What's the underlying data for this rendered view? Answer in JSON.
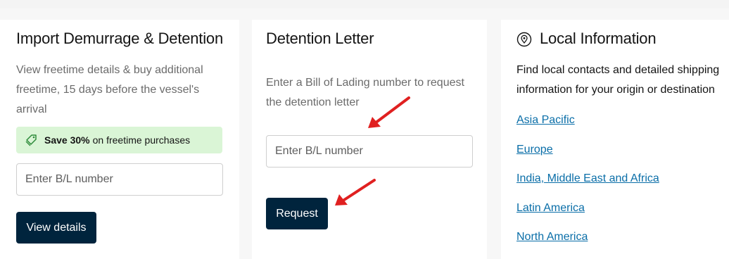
{
  "import_card": {
    "title": "Import Demurrage & Detention",
    "description": "View freetime details & buy additional freetime, 15 days before the vessel's arrival",
    "promo": {
      "bold": "Save 30%",
      "text": "on freetime purchases",
      "icon": "tag-icon"
    },
    "input_placeholder": "Enter B/L number",
    "button_label": "View details"
  },
  "detention_card": {
    "title": "Detention Letter",
    "description": "Enter a Bill of Lading number to request the detention letter",
    "input_placeholder": "Enter B/L number",
    "button_label": "Request"
  },
  "local_card": {
    "icon": "location-pin-icon",
    "title": "Local Information",
    "description": "Find local contacts and detailed shipping information for your origin or destination",
    "links": [
      "Asia Pacific",
      "Europe",
      "India, Middle East and Africa",
      "Latin America",
      "North America"
    ]
  },
  "colors": {
    "accent_dark": "#00243d",
    "link": "#0a6ea8",
    "promo_bg": "#daf5d6",
    "annotation_arrow": "#e02020"
  }
}
